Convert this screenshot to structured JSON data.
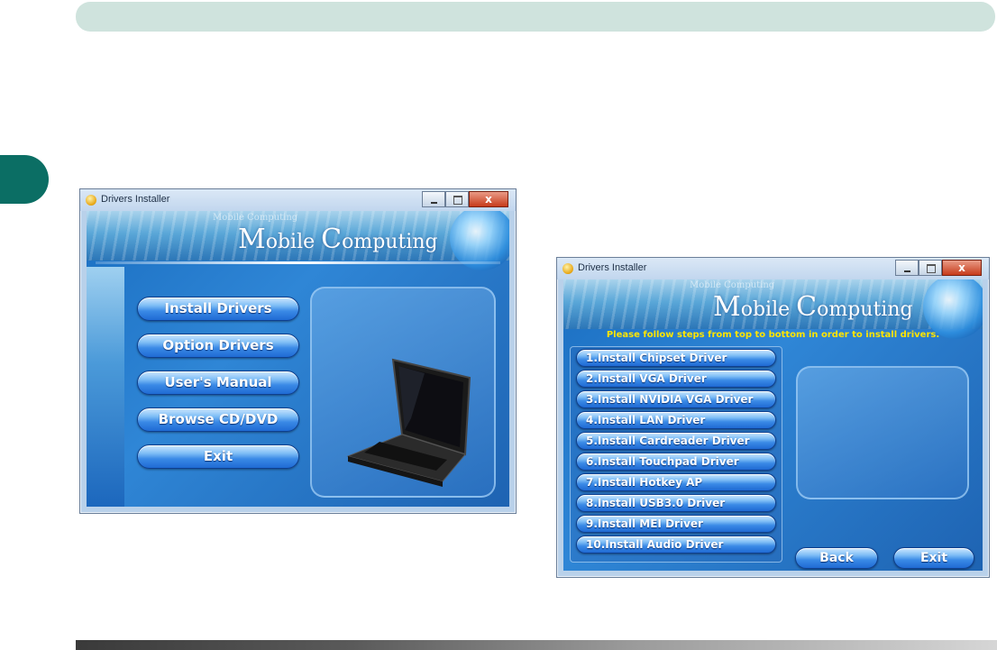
{
  "window_left": {
    "title": "Drivers Installer",
    "close_glyph": "x",
    "brand_small": "Mobile Computing",
    "brand_large_m": "M",
    "brand_large_obile": "obile ",
    "brand_large_c": "C",
    "brand_large_omputing": "omputing",
    "buttons": [
      "Install Drivers",
      "Option Drivers",
      "User's Manual",
      "Browse CD/DVD",
      "Exit"
    ]
  },
  "window_right": {
    "title": "Drivers Installer",
    "close_glyph": "x",
    "brand_small": "Mobile Computing",
    "brand_large_m": "M",
    "brand_large_obile": "obile ",
    "brand_large_c": "C",
    "brand_large_omputing": "omputing",
    "instruction": "Please follow steps from top to bottom in order to install drivers.",
    "steps": [
      "1.Install Chipset Driver",
      "2.Install VGA Driver",
      "3.Install NVIDIA VGA Driver",
      "4.Install LAN Driver",
      "5.Install Cardreader Driver",
      "6.Install Touchpad Driver",
      "7.Install Hotkey AP",
      "8.Install USB3.0 Driver",
      "9.Install MEI Driver",
      "10.Install Audio Driver"
    ],
    "back_label": "Back",
    "exit_label": "Exit"
  },
  "colors": {
    "header_bar": "#cfe3dd",
    "side_tab": "#0b6e64",
    "instruction_text": "#ffe500"
  },
  "icons": {
    "title_icon": "installer-disc-icon",
    "laptop": "laptop-image"
  }
}
